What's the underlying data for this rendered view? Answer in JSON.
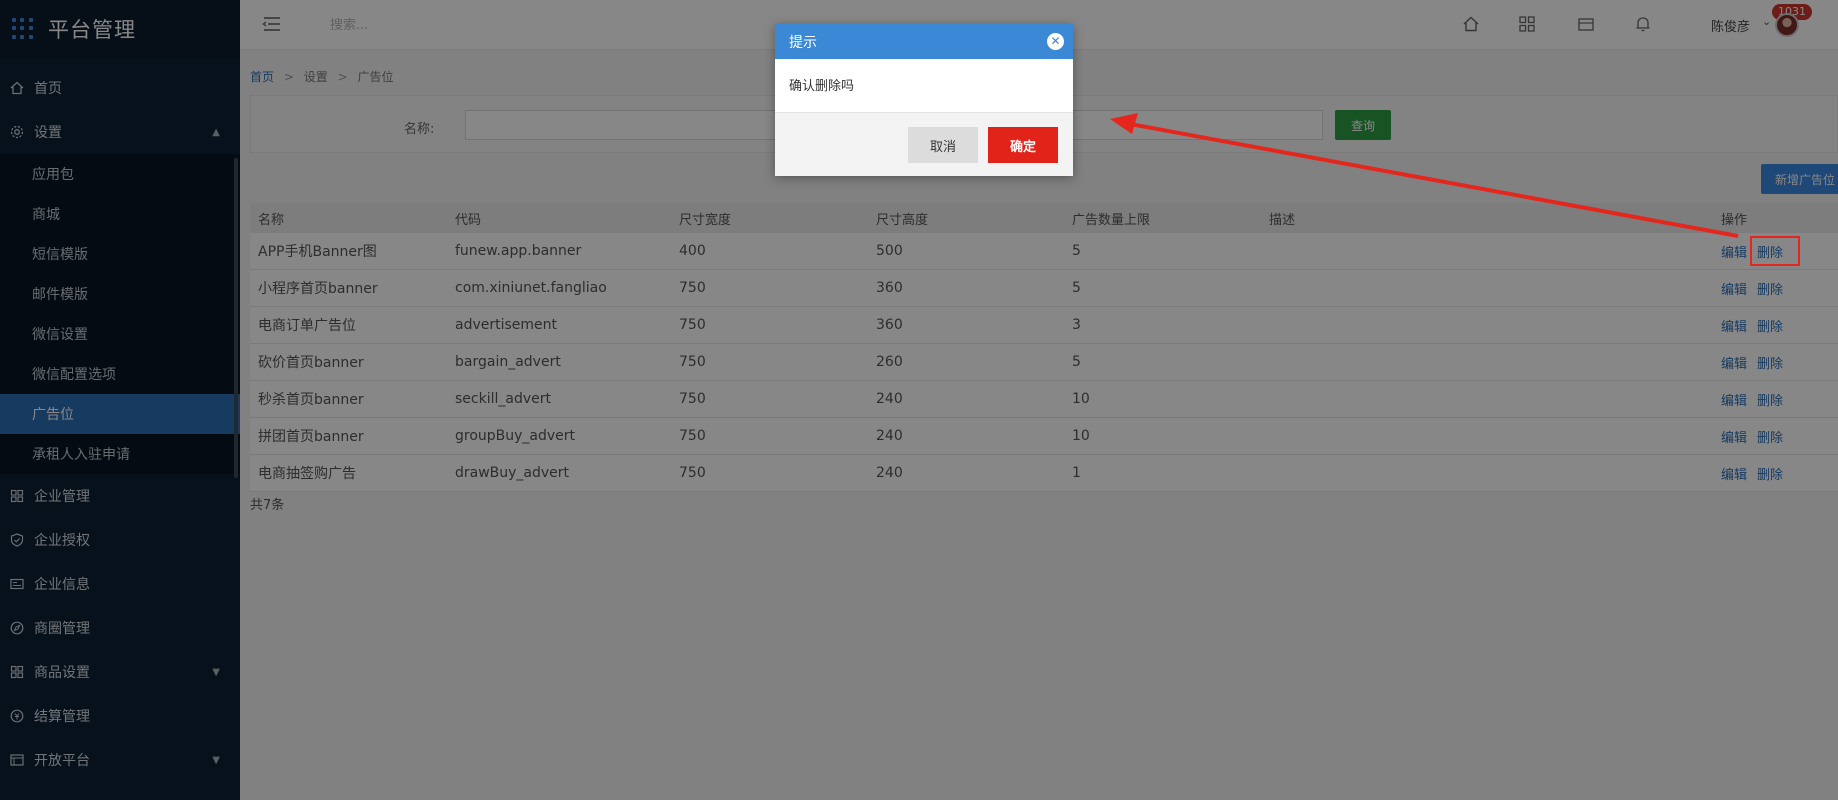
{
  "brand": {
    "title": "平台管理"
  },
  "sidebar": {
    "items": [
      {
        "label": "首页",
        "icon": "home-icon"
      },
      {
        "label": "设置",
        "icon": "gear-icon",
        "expanded": true
      }
    ],
    "submenu": [
      {
        "label": "应用包"
      },
      {
        "label": "商城"
      },
      {
        "label": "短信模版"
      },
      {
        "label": "邮件模版"
      },
      {
        "label": "微信设置"
      },
      {
        "label": "微信配置选项"
      },
      {
        "label": "广告位",
        "active": true
      },
      {
        "label": "承租人入驻申请"
      }
    ],
    "more_items": [
      {
        "label": "企业管理",
        "icon": "grid-icon"
      },
      {
        "label": "企业授权",
        "icon": "shield-icon"
      },
      {
        "label": "企业信息",
        "icon": "id-card-icon"
      },
      {
        "label": "商圈管理",
        "icon": "compass-icon"
      },
      {
        "label": "商品设置",
        "icon": "grid-icon",
        "has_caret": true
      },
      {
        "label": "结算管理",
        "icon": "coin-icon"
      },
      {
        "label": "开放平台",
        "icon": "list-icon",
        "has_caret": true
      }
    ]
  },
  "header": {
    "search_placeholder": "搜索...",
    "badge_count": "1031",
    "user_name": "陈俊彦"
  },
  "breadcrumb": {
    "home": "首页",
    "level1": "设置",
    "level2": "广告位"
  },
  "filter": {
    "label": "名称:",
    "query_button": "查询"
  },
  "add_button": "新增广告位",
  "table": {
    "headers": [
      "名称",
      "代码",
      "尺寸宽度",
      "尺寸高度",
      "广告数量上限",
      "描述",
      "操作"
    ],
    "rows": [
      {
        "name": "APP手机Banner图",
        "code": "funew.app.banner",
        "width": "400",
        "height": "500",
        "limit": "5",
        "desc": "",
        "edit": "编辑",
        "delete": "删除"
      },
      {
        "name": "小程序首页banner",
        "code": "com.xiniunet.fangliao",
        "width": "750",
        "height": "360",
        "limit": "5",
        "desc": "",
        "edit": "编辑",
        "delete": "删除"
      },
      {
        "name": "电商订单广告位",
        "code": "advertisement",
        "width": "750",
        "height": "360",
        "limit": "3",
        "desc": "",
        "edit": "编辑",
        "delete": "删除"
      },
      {
        "name": "砍价首页banner",
        "code": "bargain_advert",
        "width": "750",
        "height": "260",
        "limit": "5",
        "desc": "",
        "edit": "编辑",
        "delete": "删除"
      },
      {
        "name": "秒杀首页banner",
        "code": "seckill_advert",
        "width": "750",
        "height": "240",
        "limit": "10",
        "desc": "",
        "edit": "编辑",
        "delete": "删除"
      },
      {
        "name": "拼团首页banner",
        "code": "groupBuy_advert",
        "width": "750",
        "height": "240",
        "limit": "10",
        "desc": "",
        "edit": "编辑",
        "delete": "删除"
      },
      {
        "name": "电商抽签购广告",
        "code": "drawBuy_advert",
        "width": "750",
        "height": "240",
        "limit": "1",
        "desc": "",
        "edit": "编辑",
        "delete": "删除"
      }
    ],
    "total": "共7条"
  },
  "dialog": {
    "title": "提示",
    "message": "确认删除吗",
    "cancel": "取消",
    "confirm": "确定"
  },
  "colors": {
    "sidebar_bg": "#0e2033",
    "active_item": "#2d6fb6",
    "dialog_header": "#3b88d6",
    "confirm_button": "#e2231a",
    "query_button": "#2e9e44",
    "annotation": "#e5261d"
  }
}
